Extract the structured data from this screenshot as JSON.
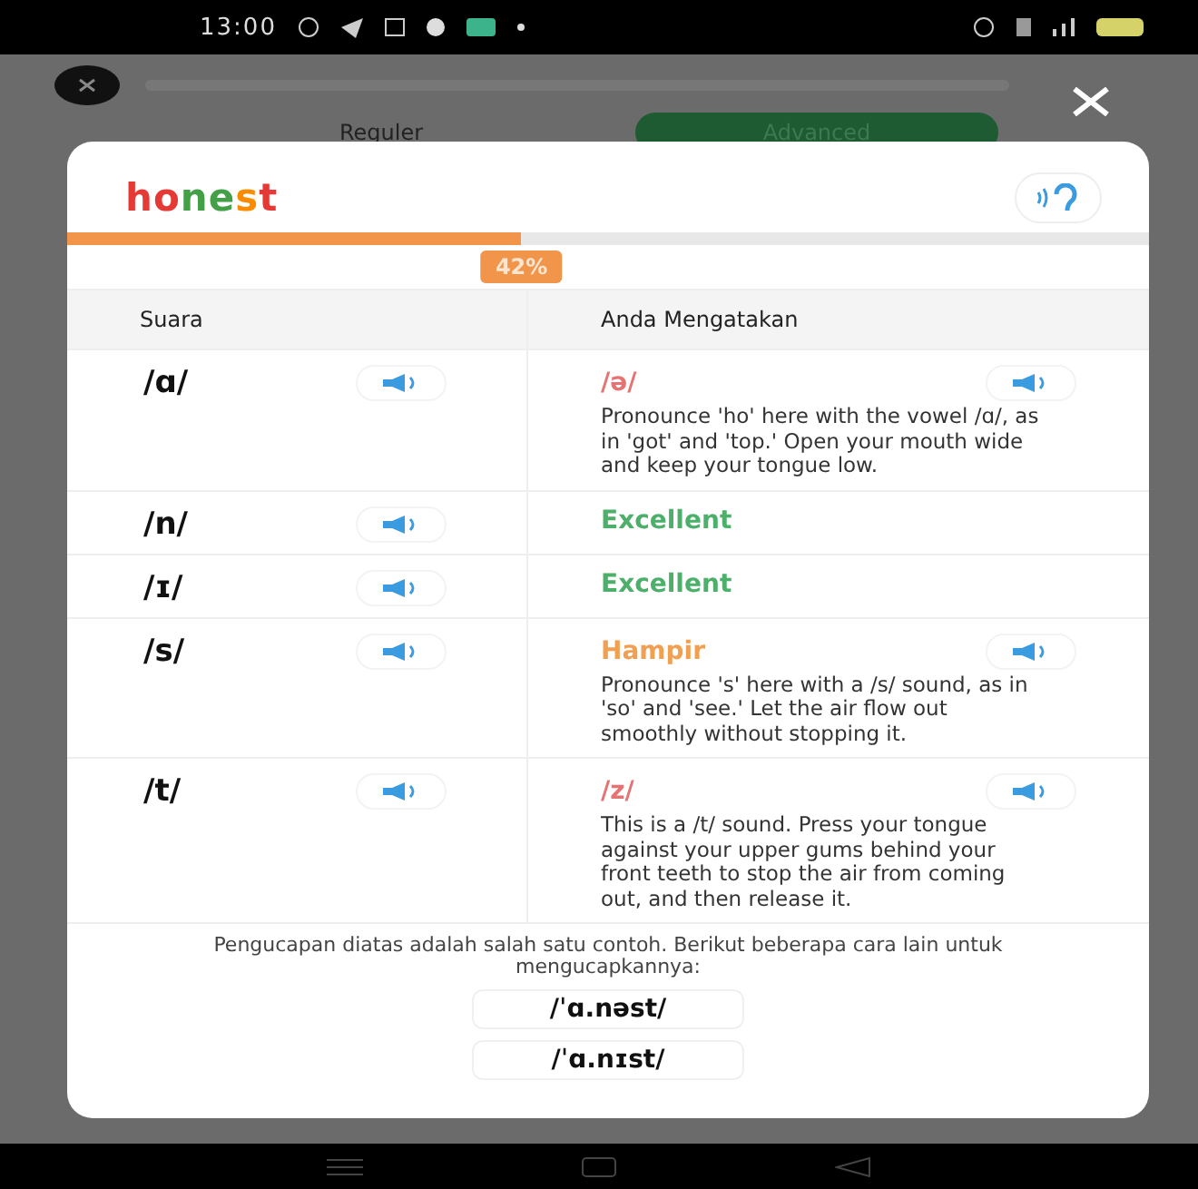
{
  "status_bar": {
    "time": "13:00"
  },
  "background": {
    "tabs": [
      {
        "label": "Reguler",
        "selected": false
      },
      {
        "label": "Advanced",
        "selected": true
      }
    ]
  },
  "modal": {
    "word": [
      {
        "text": "ho",
        "color": "#e53935"
      },
      {
        "text": "ne",
        "color": "#43a047"
      },
      {
        "text": "s",
        "color": "#fb8c00"
      },
      {
        "text": "t",
        "color": "#e53935"
      }
    ],
    "progress": {
      "level": 0.42,
      "reading": "42%"
    },
    "columns": [
      "Suara",
      "Anda Mengatakan"
    ],
    "rows": [
      {
        "phoneme": "/ɑ/",
        "result": "/ə/",
        "kind": "error",
        "tip": "Pronounce 'ho' here with the vowel /ɑ/, as in 'got' and 'top.' Open your mouth wide and keep your tongue low."
      },
      {
        "phoneme": "/n/",
        "result": "Excellent",
        "kind": "excellent"
      },
      {
        "phoneme": "/ɪ/",
        "result": "Excellent",
        "kind": "excellent"
      },
      {
        "phoneme": "/s/",
        "result": "Hampir",
        "kind": "close",
        "tip": "Pronounce 's' here with a /s/ sound, as in 'so' and 'see.' Let the air flow out smoothly without stopping it."
      },
      {
        "phoneme": "/t/",
        "result": "/z/",
        "kind": "error",
        "tip": "This is a /t/ sound. Press your tongue against your upper gums behind your front teeth to stop the air from coming out, and then release it."
      }
    ],
    "note": "Pengucapan diatas adalah salah satu contoh. Berikut beberapa cara lain untuk mengucapkannya:",
    "variants": [
      "/ˈɑ.nəst/",
      "/ˈɑ.nɪst/"
    ]
  }
}
